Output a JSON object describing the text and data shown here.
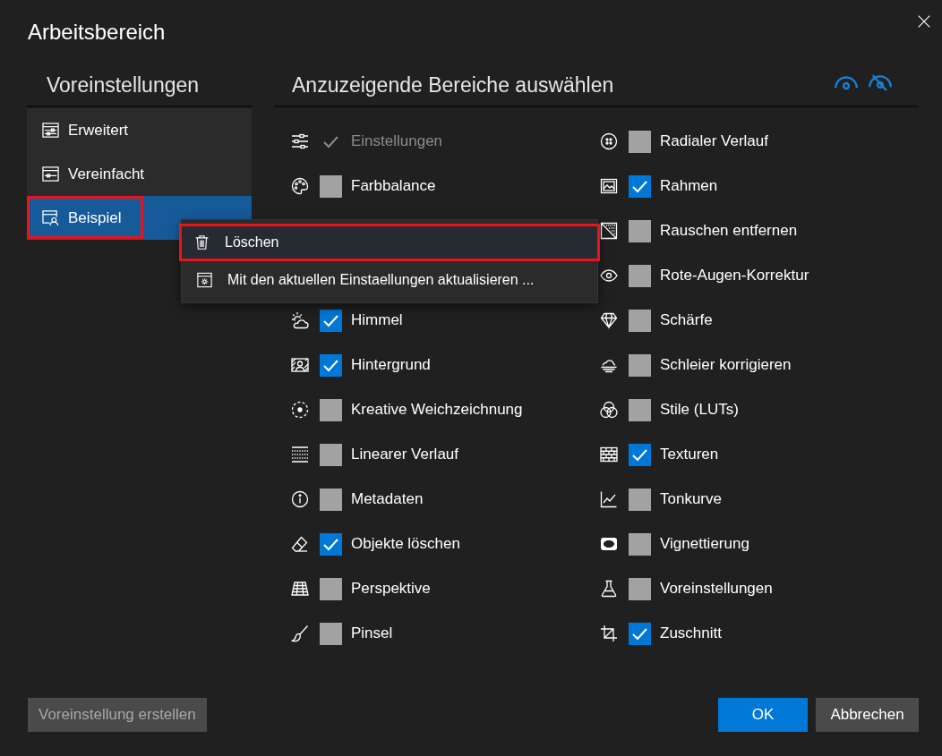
{
  "window": {
    "title": "Arbeitsbereich"
  },
  "presets": {
    "heading": "Voreinstellungen",
    "items": [
      {
        "label": "Erweitert",
        "selected": false,
        "highlighted": false
      },
      {
        "label": "Vereinfacht",
        "selected": false,
        "highlighted": false
      },
      {
        "label": "Beispiel",
        "selected": true,
        "highlighted": true
      }
    ]
  },
  "context_menu": {
    "items": [
      {
        "label": "Löschen",
        "highlighted": true
      },
      {
        "label": "Mit den aktuellen Einstaellungen aktualisieren ...",
        "highlighted": false
      }
    ]
  },
  "areas": {
    "heading": "Anzuzeigende Bereiche auswählen",
    "column_1": [
      {
        "items": [
          {
            "label": "Einstellungen",
            "checked": true,
            "disabled": true
          },
          {
            "label": "Farbbalance",
            "checked": false,
            "disabled": false
          }
        ]
      },
      {
        "items": [
          {
            "label": "Himmel",
            "checked": true,
            "disabled": false
          },
          {
            "label": "Hintergrund",
            "checked": true,
            "disabled": false
          },
          {
            "label": "Kreative Weichzeichnung",
            "checked": false,
            "disabled": false
          },
          {
            "label": "Linearer Verlauf",
            "checked": false,
            "disabled": false
          },
          {
            "label": "Metadaten",
            "checked": false,
            "disabled": false
          },
          {
            "label": "Objekte löschen",
            "checked": true,
            "disabled": false
          },
          {
            "label": "Perspektive",
            "checked": false,
            "disabled": false
          },
          {
            "label": "Pinsel",
            "checked": false,
            "disabled": false
          }
        ]
      }
    ],
    "column_2": [
      {
        "label": "Radialer Verlauf",
        "checked": false,
        "disabled": false
      },
      {
        "label": "Rahmen",
        "checked": true,
        "disabled": false
      },
      {
        "label": "Rauschen entfernen",
        "checked": false,
        "disabled": false
      },
      {
        "label": "Rote-Augen-Korrektur",
        "checked": false,
        "disabled": false
      },
      {
        "label": "Schärfe",
        "checked": false,
        "disabled": false
      },
      {
        "label": "Schleier korrigieren",
        "checked": false,
        "disabled": false
      },
      {
        "label": "Stile (LUTs)",
        "checked": false,
        "disabled": false
      },
      {
        "label": "Texturen",
        "checked": true,
        "disabled": false
      },
      {
        "label": "Tonkurve",
        "checked": false,
        "disabled": false
      },
      {
        "label": "Vignettierung",
        "checked": false,
        "disabled": false
      },
      {
        "label": "Voreinstellungen",
        "checked": false,
        "disabled": false
      },
      {
        "label": "Zuschnitt",
        "checked": true,
        "disabled": false
      }
    ]
  },
  "footer": {
    "create_button": {
      "label": "Voreinstellung erstellen",
      "disabled": true
    },
    "buttons": [
      {
        "label": "OK",
        "kind": "primary"
      },
      {
        "label": "Abbrechen",
        "kind": "secondary"
      }
    ]
  }
}
